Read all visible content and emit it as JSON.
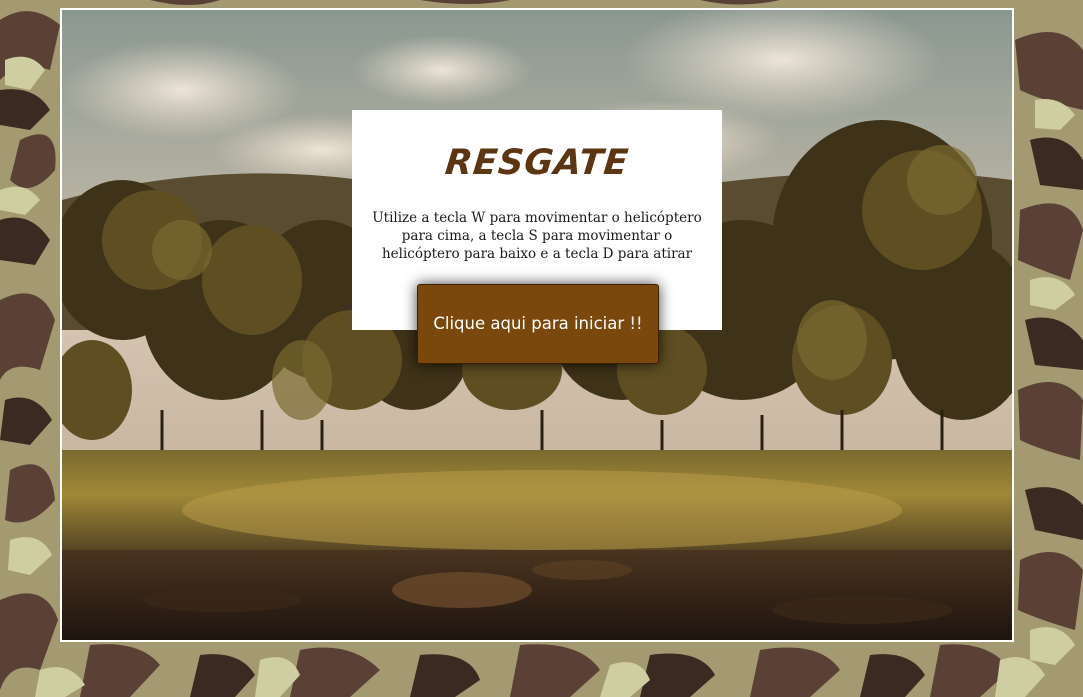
{
  "game": {
    "title": "RESGATE",
    "instructions": "Utilize a tecla W para movimentar o helicóptero para cima, a tecla S para movimentar o helicóptero para baixo e a tecla D para atirar",
    "start_button_label": "Clique aqui para iniciar !!"
  },
  "theme": {
    "title_color": "#5c3512",
    "button_color": "#7a480c",
    "frame_border_color": "#ffffff",
    "camo_colors": [
      "#9c9470",
      "#5b4035",
      "#3a2a22",
      "#c8c69a",
      "#6e5a40"
    ]
  },
  "icons": {
    "background_pattern": "camouflage-pattern",
    "scene": "forest-landscape"
  }
}
